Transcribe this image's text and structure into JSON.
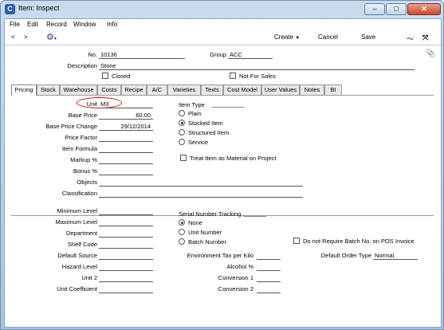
{
  "window": {
    "title": "Item: Inspect",
    "minimize": "–",
    "maximize": "□",
    "close": "✕"
  },
  "menu": {
    "items": [
      "File",
      "Edit",
      "Record",
      "Window",
      "Info"
    ]
  },
  "toolbar": {
    "back": "<",
    "forward": ">",
    "create": "Create",
    "cancel": "Cancel",
    "save": "Save"
  },
  "header": {
    "no_label": "No.",
    "no_value": "10136",
    "group_label": "Group",
    "group_value": "ACC",
    "description_label": "Description",
    "description_value": "Stone",
    "closed_label": "Closed",
    "not_for_sales_label": "Not For Sales"
  },
  "tabs": [
    "Pricing",
    "Stock",
    "Warehouse",
    "Costs",
    "Recipe",
    "A/C",
    "Varieties",
    "Texts",
    "Cost Model",
    "User Values",
    "Notes",
    "BI"
  ],
  "active_tab": "Pricing",
  "pricing": {
    "unit_label": "Unit",
    "unit_value": "M3",
    "base_price_label": "Base Price",
    "base_price_value": "60.00",
    "base_price_change_label": "Base Price Change",
    "base_price_change_value": "29/12/2014",
    "price_factor_label": "Price Factor",
    "item_formula_label": "Item Formula",
    "markup_label": "Markup %",
    "bonus_label": "Bonus %",
    "objects_label": "Objects",
    "classification_label": "Classification",
    "item_type_label": "Item Type",
    "item_types": [
      "Plain",
      "Stocked Item",
      "Structured Item",
      "Service"
    ],
    "selected_item_type": "Stocked Item",
    "treat_as_material_label": "Treat Item as Material on Project"
  },
  "stock": {
    "minimum_level_label": "Minimum Level",
    "maximum_level_label": "Maximum Level",
    "department_label": "Department",
    "shelf_code_label": "Shelf Code",
    "default_source_label": "Default Source",
    "hazard_level_label": "Hazard Level",
    "unit2_label": "Unit 2",
    "unit_coefficient_label": "Unit Coefficient",
    "serial_tracking_label": "Serial Number Tracking",
    "serial_options": [
      "None",
      "Unit Number",
      "Batch Number"
    ],
    "selected_serial": "None",
    "env_tax_label": "Environment Tax per Kilo",
    "alcohol_label": "Alcohol %",
    "conversion1_label": "Conversion 1",
    "conversion2_label": "Conversion 2",
    "no_batch_pos_label": "Do not Require Batch No. on POS Invoice",
    "default_order_type_label": "Default Order Type",
    "default_order_type_value": "Normal"
  },
  "colors": {
    "highlight_circle": "#dd1111",
    "frame": "#a9c4e2"
  }
}
